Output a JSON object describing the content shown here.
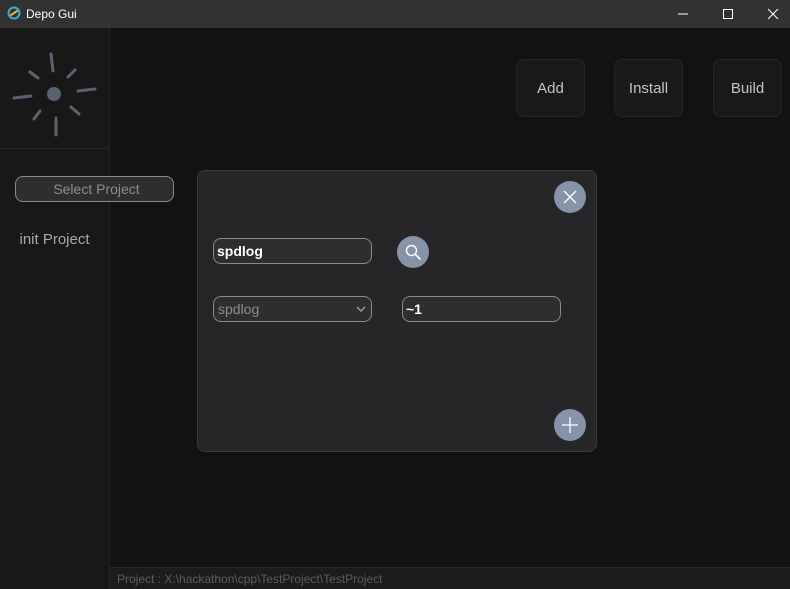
{
  "window": {
    "title": "Depo Gui",
    "icons": [
      "app-logo-icon",
      "minimize-icon",
      "maximize-icon",
      "close-icon"
    ]
  },
  "sidebar": {
    "logo_icon": "spinner-logo-icon",
    "items": [
      {
        "label": "Select Project"
      },
      {
        "label": "init Project"
      }
    ]
  },
  "toolbar": {
    "add_label": "Add",
    "install_label": "Install",
    "build_label": "Build"
  },
  "modal": {
    "search_value": "spdlog",
    "search_icon": "magnifier-icon",
    "close_icon": "close-x-icon",
    "package_select_value": "spdlog",
    "version_value": "~1",
    "add_icon": "plus-icon"
  },
  "status": {
    "text": "Project : X:\\hackathon\\cpp\\TestProject\\TestProject"
  },
  "colors": {
    "accent_button": "#8793a9",
    "background": "#121212",
    "sidebar": "#181818",
    "modal": "#262628"
  }
}
